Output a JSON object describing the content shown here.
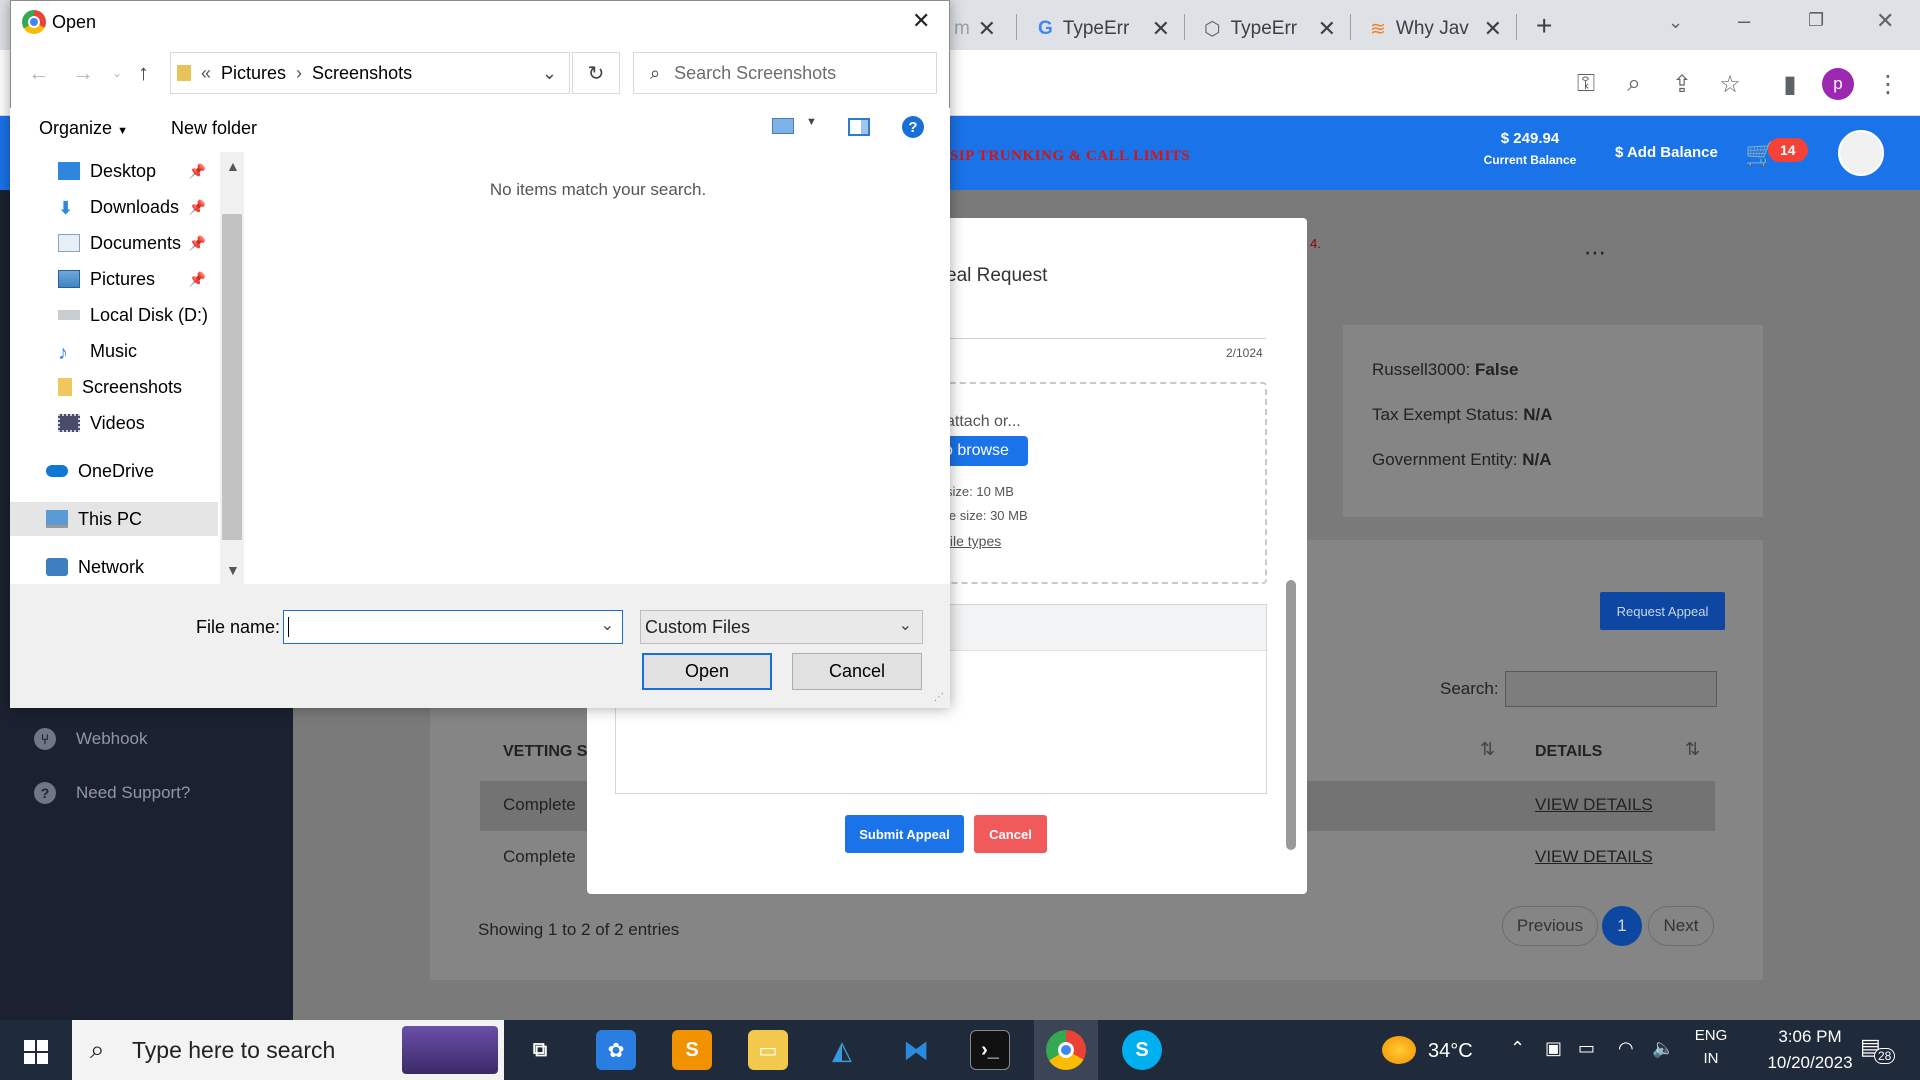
{
  "browser": {
    "tabs": [
      {
        "label": "m"
      },
      {
        "label": "TypeErr"
      },
      {
        "label": "TypeErr"
      },
      {
        "label": "Why Jav"
      }
    ],
    "new_tab_label": "+"
  },
  "site": {
    "nav_red_text": "SIP TRUNKING & CALL LIMITS",
    "balance_amount": "$ 249.94",
    "balance_label": "Current Balance",
    "add_balance_label": "$ Add Balance",
    "cart_count": "14",
    "sidebar_items": [
      {
        "label": "Webhook"
      },
      {
        "label": "Need Support?"
      }
    ],
    "info_lines": [
      {
        "label": "Russell3000:",
        "value": "False"
      },
      {
        "label": "Tax Exempt Status:",
        "value": "N/A"
      },
      {
        "label": "Government Entity:",
        "value": "N/A"
      }
    ],
    "red_fragment": "4.",
    "request_appeal_label": "Request Appeal",
    "search_label": "Search:",
    "table": {
      "headers": [
        "VETTING S",
        "DETAILS"
      ],
      "rows": [
        {
          "status": "Complete",
          "details": "VIEW DETAILS"
        },
        {
          "status": "Complete",
          "details": "VIEW DETAILS"
        }
      ]
    },
    "showing_entries": "Showing 1 to 2 of 2 entries",
    "pagination": {
      "previous": "Previous",
      "current": "1",
      "next": "Next"
    }
  },
  "modal": {
    "title_fragment": "eal Request",
    "char_count": "2/1024",
    "attach_text": "attach or...",
    "browse_label": "o browse",
    "max_size_1": "size: 10 MB",
    "max_size_2": "le size: 30 MB",
    "file_types_link": "file types",
    "submit_label": "Submit Appeal",
    "cancel_label": "Cancel"
  },
  "dialog": {
    "title": "Open",
    "breadcrumb": [
      "Pictures",
      "Screenshots"
    ],
    "breadcrumb_prefix": "«",
    "search_placeholder": "Search Screenshots",
    "organize_label": "Organize",
    "new_folder_label": "New folder",
    "empty_message": "No items match your search.",
    "nav_items": [
      {
        "label": "Desktop",
        "icon": "desktop-icon",
        "pinned": true
      },
      {
        "label": "Downloads",
        "icon": "downloads-icon",
        "pinned": true
      },
      {
        "label": "Documents",
        "icon": "documents-icon",
        "pinned": true
      },
      {
        "label": "Pictures",
        "icon": "pictures-icon",
        "pinned": true
      },
      {
        "label": "Local Disk (D:)",
        "icon": "disk-icon",
        "pinned": false
      },
      {
        "label": "Music",
        "icon": "music-icon",
        "pinned": false
      },
      {
        "label": "Screenshots",
        "icon": "folder-icon",
        "pinned": false
      },
      {
        "label": "Videos",
        "icon": "videos-icon",
        "pinned": false
      },
      {
        "label": "OneDrive",
        "icon": "onedrive-icon",
        "pinned": false
      },
      {
        "label": "This PC",
        "icon": "pc-icon",
        "pinned": false,
        "selected": true
      },
      {
        "label": "Network",
        "icon": "network-icon",
        "pinned": false
      }
    ],
    "file_name_label": "File name:",
    "file_name_value": "",
    "file_type_value": "Custom Files",
    "open_label": "Open",
    "cancel_label": "Cancel"
  },
  "taskbar": {
    "search_placeholder": "Type here to search",
    "temperature": "34°C",
    "language": "ENG",
    "region": "IN",
    "time": "3:06 PM",
    "date": "10/20/2023",
    "notification_count": "28"
  },
  "colors": {
    "site_header": "#1a73e8",
    "sidebar": "#1b2130",
    "submit": "#1a73e8",
    "cancel": "#f05a5a",
    "taskbar": "#1f2a3a"
  }
}
